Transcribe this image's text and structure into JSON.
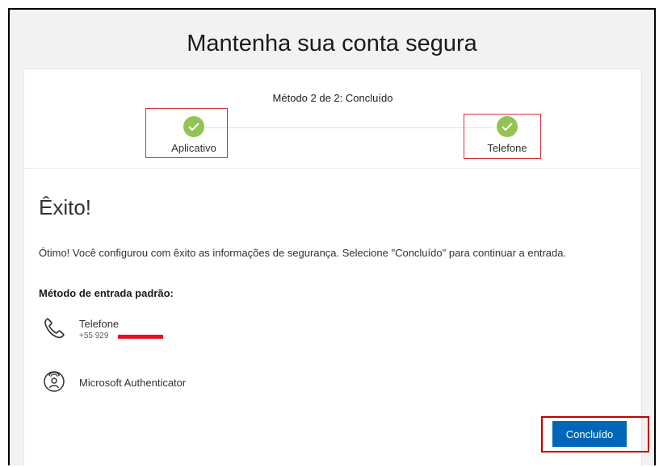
{
  "page": {
    "title": "Mantenha sua conta segura"
  },
  "wizard": {
    "step_label": "Método 2 de 2: Concluído",
    "steps": [
      {
        "label": "Aplicativo",
        "status": "complete"
      },
      {
        "label": "Telefone",
        "status": "complete"
      }
    ]
  },
  "result": {
    "heading": "Êxito!",
    "message": "Ótimo! Você configurou com êxito as informações de segurança. Selecione \"Concluído\" para continuar a entrada.",
    "default_method_label": "Método de entrada padrão:"
  },
  "methods": [
    {
      "name": "Telefone",
      "detail": "+55 929",
      "icon": "phone-icon"
    },
    {
      "name": "Microsoft Authenticator",
      "icon": "authenticator-lock-icon"
    }
  ],
  "actions": {
    "done_label": "Concluído"
  },
  "colors": {
    "primary": "#0067b8",
    "success": "#92c353",
    "highlight": "#d13438",
    "redaction": "#e81123"
  }
}
